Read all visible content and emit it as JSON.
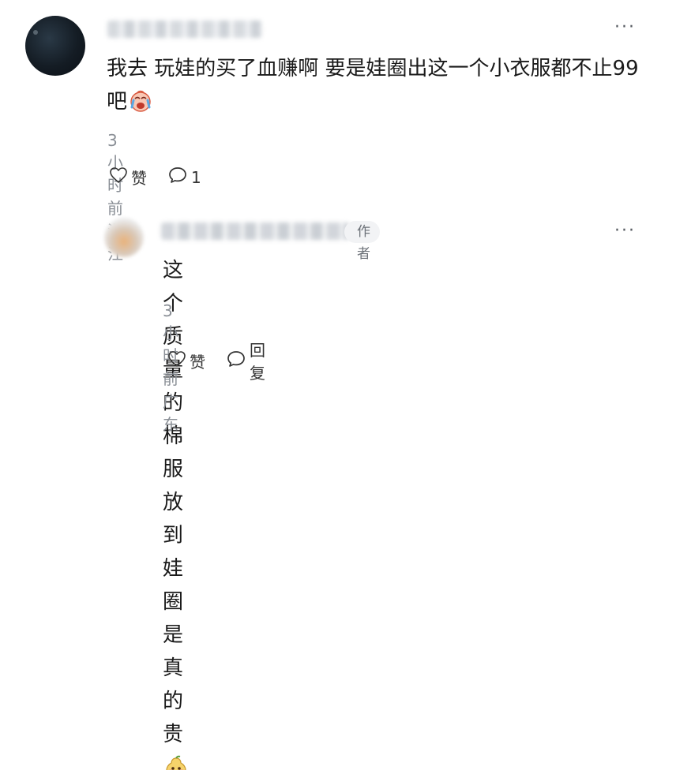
{
  "comment": {
    "text": "我去 玩娃的买了血赚啊 要是娃圈出这一个小衣服都不止99吧",
    "emoji_icon": "crying-emoji-icon",
    "time": "3小时前",
    "location": "浙江",
    "like_label": "赞",
    "reply_count": "1"
  },
  "reply": {
    "badge": "作者",
    "text": "这个质量的棉服放到娃圈是真的贵",
    "emoji_icon": "smiling-pear-emoji-icon",
    "time": "3小时前",
    "location": "广东",
    "like_label": "赞",
    "reply_label": "回复"
  },
  "more_icon_glyph": "···"
}
